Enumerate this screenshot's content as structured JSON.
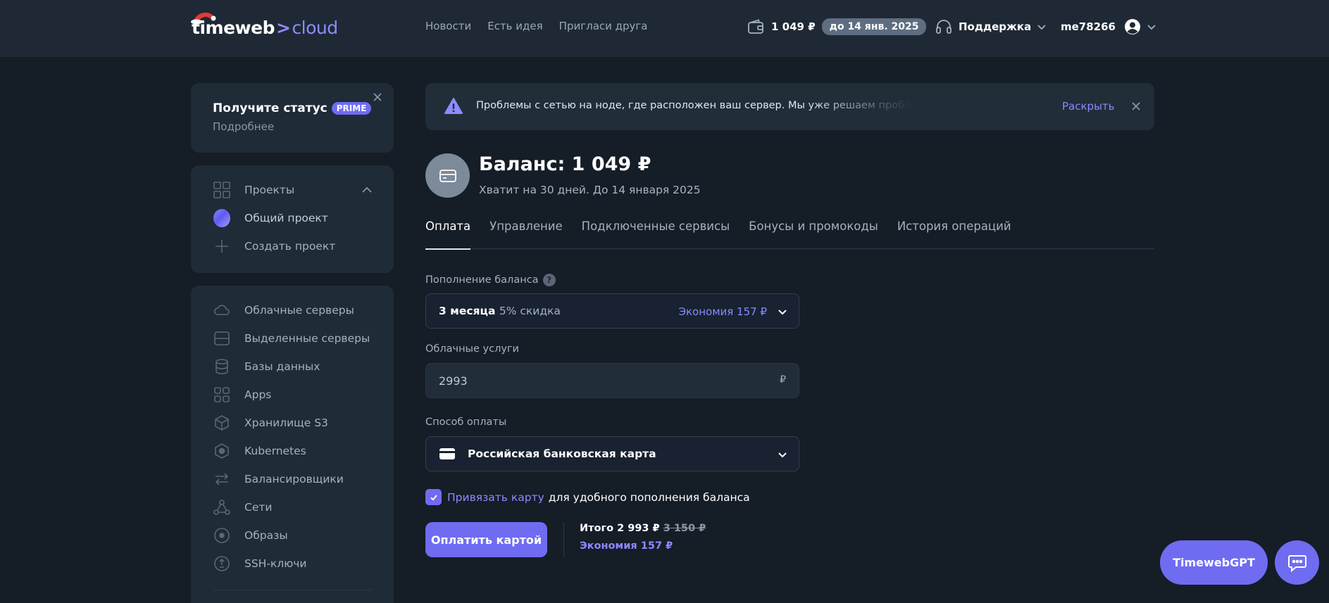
{
  "header": {
    "logo_main": "timeweb",
    "logo_arrow": ">",
    "logo_sub": "cloud",
    "nav": [
      "Новости",
      "Есть идея",
      "Пригласи друга"
    ],
    "balance": "1 049 ₽",
    "balance_until": "до 14 янв. 2025",
    "support": "Поддержка",
    "username": "me78266"
  },
  "sidebar": {
    "prime_title": "Получите статус",
    "prime_badge": "PRIME",
    "prime_more": "Подробнее",
    "projects_label": "Проекты",
    "projects": [
      {
        "label": "Общий проект",
        "icon": "project-dot-icon"
      },
      {
        "label": "Создать проект",
        "icon": "plus-icon"
      }
    ],
    "services": [
      {
        "label": "Облачные серверы",
        "icon": "cloud-icon"
      },
      {
        "label": "Выделенные серверы",
        "icon": "server-icon"
      },
      {
        "label": "Базы данных",
        "icon": "database-icon"
      },
      {
        "label": "Apps",
        "icon": "apps-icon"
      },
      {
        "label": "Хранилище S3",
        "icon": "storage-cube-icon"
      },
      {
        "label": "Kubernetes",
        "icon": "kubernetes-icon"
      },
      {
        "label": "Балансировщики",
        "icon": "balancer-arrows-icon"
      },
      {
        "label": "Сети",
        "icon": "network-icon"
      },
      {
        "label": "Образы",
        "icon": "image-disc-icon"
      },
      {
        "label": "SSH-ключи",
        "icon": "key-icon"
      }
    ]
  },
  "alert": {
    "text": "Проблемы с сетью на ноде, где расположен ваш сервер. Мы уже решаем проблему и ...",
    "expand": "Раскрыть"
  },
  "balance": {
    "title": "Баланс: 1 049 ₽",
    "subtitle": "Хватит на 30 дней. До 14 января 2025"
  },
  "tabs": [
    "Оплата",
    "Управление",
    "Подключенные сервисы",
    "Бонусы и промокоды",
    "История операций"
  ],
  "form": {
    "topup_label": "Пополнение баланса",
    "topup_help": "?",
    "period": "3 месяца",
    "discount": "5% скидка",
    "period_saving": "Экономия 157 ₽",
    "cloud_label": "Облачные услуги",
    "cloud_value": "2993",
    "currency": "₽",
    "method_label": "Способ оплаты",
    "method_value": "Российская банковская карта",
    "bind_link": "Привязать карту",
    "bind_text": "для удобного пополнения баланса",
    "pay_button": "Оплатить картой",
    "total_label": "Итого 2 993 ₽",
    "total_old": "3 150 ₽",
    "total_saving": "Экономия 157 ₽"
  },
  "floating": {
    "gpt": "TimewebGPT"
  },
  "colors": {
    "accent": "#6f6cf2",
    "link": "#8b89ff",
    "background": "#151d27",
    "card": "#202b38"
  }
}
